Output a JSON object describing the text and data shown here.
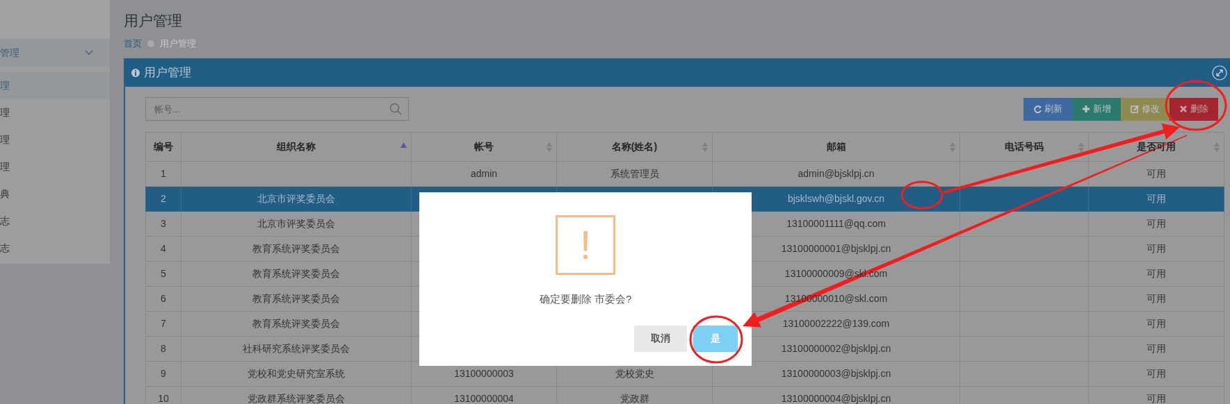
{
  "sidebar": {
    "items": [
      {
        "label": "管理",
        "expanded": true,
        "children": [
          {
            "label": "理",
            "selected": true
          },
          {
            "label": "理",
            "selected": false
          },
          {
            "label": "理",
            "selected": false
          },
          {
            "label": "理",
            "selected": false
          },
          {
            "label": "典",
            "selected": false
          },
          {
            "label": "志",
            "selected": false
          },
          {
            "label": "志",
            "selected": false
          }
        ]
      }
    ]
  },
  "page": {
    "title": "用户管理",
    "breadcrumb": [
      "首页",
      "用户管理"
    ]
  },
  "panel": {
    "title": "用户管理",
    "search": {
      "placeholder": "帐号..."
    },
    "buttons": [
      {
        "kind": "refresh",
        "label": "刷新"
      },
      {
        "kind": "add",
        "label": "新增"
      },
      {
        "kind": "edit",
        "label": "修改"
      },
      {
        "kind": "delete",
        "label": "删除"
      }
    ],
    "table": {
      "columns": [
        {
          "label": "编号",
          "sortable": false
        },
        {
          "label": "组织名称",
          "sortable": true,
          "sorted": true
        },
        {
          "label": "帐号",
          "sortable": true,
          "sorted": false
        },
        {
          "label": "名称(姓名)",
          "sortable": true,
          "sorted": false
        },
        {
          "label": "邮箱",
          "sortable": true,
          "sorted": false
        },
        {
          "label": "电话号码",
          "sortable": true,
          "sorted": false
        },
        {
          "label": "是否可用",
          "sortable": true,
          "sorted": false
        }
      ],
      "rows": [
        {
          "cells": [
            "1",
            "",
            "admin",
            "系统管理员",
            "admin@bjsklpj.cn",
            "",
            "可用"
          ],
          "selected": false
        },
        {
          "cells": [
            "2",
            "北京市评奖委员会",
            "",
            "",
            "bjsklswh@bjskl.gov.cn",
            "",
            "可用"
          ],
          "selected": true
        },
        {
          "cells": [
            "3",
            "北京市评奖委员会",
            "",
            "",
            "13100001111@qq.com",
            "",
            "可用"
          ],
          "selected": false
        },
        {
          "cells": [
            "4",
            "教育系统评奖委员会",
            "",
            "",
            "13100000001@bjsklpj.cn",
            "",
            "可用"
          ],
          "selected": false
        },
        {
          "cells": [
            "5",
            "教育系统评奖委员会",
            "",
            "",
            "13100000009@skl.com",
            "",
            "可用"
          ],
          "selected": false
        },
        {
          "cells": [
            "6",
            "教育系统评奖委员会",
            "",
            "",
            "13100000010@skl.com",
            "",
            "可用"
          ],
          "selected": false
        },
        {
          "cells": [
            "7",
            "教育系统评奖委员会",
            "",
            "",
            "13100002222@139.com",
            "",
            "可用"
          ],
          "selected": false
        },
        {
          "cells": [
            "8",
            "社科研究系统评奖委员会",
            "",
            "",
            "13100000002@bjsklpj.cn",
            "",
            "可用"
          ],
          "selected": false
        },
        {
          "cells": [
            "9",
            "党校和党史研究室系统",
            "13100000003",
            "党校党史",
            "13100000003@bjsklpj.cn",
            "",
            "可用"
          ],
          "selected": false
        },
        {
          "cells": [
            "10",
            "党政群系统评奖委员会",
            "13100000004",
            "党政群",
            "13100000004@bjsklpj.cn",
            "",
            "可用"
          ],
          "selected": false
        }
      ]
    }
  },
  "dialog": {
    "icon": "!",
    "message": "确定要删除 市委会?",
    "buttons": [
      {
        "kind": "cancel",
        "label": "取消"
      },
      {
        "kind": "confirm",
        "label": "是"
      }
    ]
  },
  "annotations": [
    {
      "kind": "circle"
    },
    {
      "kind": "circle"
    },
    {
      "kind": "circle"
    },
    {
      "kind": "arrow"
    },
    {
      "kind": "arrow"
    }
  ]
}
